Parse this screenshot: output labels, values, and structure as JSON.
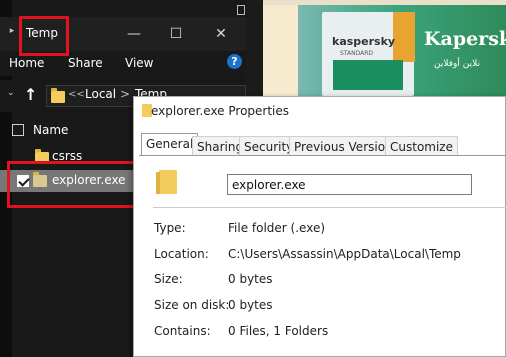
{
  "explorer": {
    "window_title": "Temp",
    "ribbon": {
      "home": "Home",
      "share": "Share",
      "view": "View"
    },
    "help": "?",
    "breadcrumb": {
      "sep": "<<",
      "local": "Local",
      "arrow": ">",
      "current": "Temp"
    },
    "column_name": "Name",
    "items": [
      {
        "name": "csrss",
        "selected": false
      },
      {
        "name": "explorer.exe",
        "selected": true
      }
    ]
  },
  "browser": {
    "brand": "Kapersky",
    "product_name": "kaspersky",
    "product_edition": "STANDARD",
    "arabic_text": "نلاين أوفلاين",
    "colors": {
      "accent_red": "#c81414",
      "banner_green": "#2e8b5a"
    }
  },
  "properties": {
    "title": "explorer.exe Properties",
    "tabs": [
      "General",
      "Sharing",
      "Security",
      "Previous Versions",
      "Customize"
    ],
    "active_tab": "General",
    "name_value": "explorer.exe",
    "fields": [
      {
        "label": "Type:",
        "value": "File folder (.exe)"
      },
      {
        "label": "Location:",
        "value": "C:\\Users\\Assassin\\AppData\\Local\\Temp"
      },
      {
        "label": "Size:",
        "value": "0 bytes"
      },
      {
        "label": "Size on disk:",
        "value": "0 bytes"
      },
      {
        "label": "Contains:",
        "value": "0 Files, 1 Folders"
      }
    ]
  },
  "annotation_color": "#e0141e"
}
